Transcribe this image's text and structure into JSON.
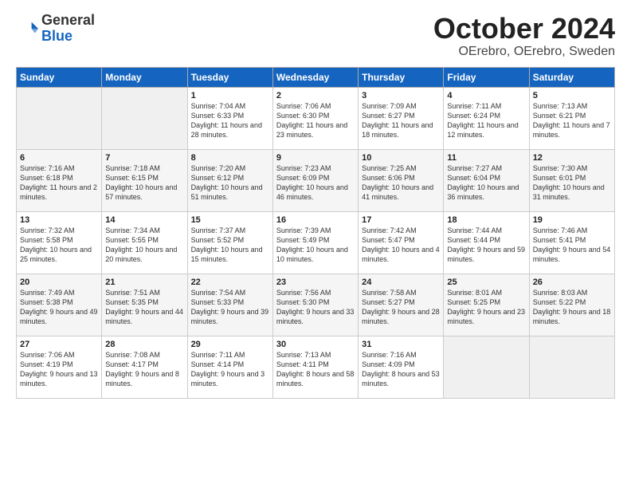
{
  "logo": {
    "general": "General",
    "blue": "Blue"
  },
  "title": "October 2024",
  "subtitle": "OErebro, OErebro, Sweden",
  "weekdays": [
    "Sunday",
    "Monday",
    "Tuesday",
    "Wednesday",
    "Thursday",
    "Friday",
    "Saturday"
  ],
  "weeks": [
    [
      {
        "day": "",
        "info": ""
      },
      {
        "day": "",
        "info": ""
      },
      {
        "day": "1",
        "info": "Sunrise: 7:04 AM\nSunset: 6:33 PM\nDaylight: 11 hours and 28 minutes."
      },
      {
        "day": "2",
        "info": "Sunrise: 7:06 AM\nSunset: 6:30 PM\nDaylight: 11 hours and 23 minutes."
      },
      {
        "day": "3",
        "info": "Sunrise: 7:09 AM\nSunset: 6:27 PM\nDaylight: 11 hours and 18 minutes."
      },
      {
        "day": "4",
        "info": "Sunrise: 7:11 AM\nSunset: 6:24 PM\nDaylight: 11 hours and 12 minutes."
      },
      {
        "day": "5",
        "info": "Sunrise: 7:13 AM\nSunset: 6:21 PM\nDaylight: 11 hours and 7 minutes."
      }
    ],
    [
      {
        "day": "6",
        "info": "Sunrise: 7:16 AM\nSunset: 6:18 PM\nDaylight: 11 hours and 2 minutes."
      },
      {
        "day": "7",
        "info": "Sunrise: 7:18 AM\nSunset: 6:15 PM\nDaylight: 10 hours and 57 minutes."
      },
      {
        "day": "8",
        "info": "Sunrise: 7:20 AM\nSunset: 6:12 PM\nDaylight: 10 hours and 51 minutes."
      },
      {
        "day": "9",
        "info": "Sunrise: 7:23 AM\nSunset: 6:09 PM\nDaylight: 10 hours and 46 minutes."
      },
      {
        "day": "10",
        "info": "Sunrise: 7:25 AM\nSunset: 6:06 PM\nDaylight: 10 hours and 41 minutes."
      },
      {
        "day": "11",
        "info": "Sunrise: 7:27 AM\nSunset: 6:04 PM\nDaylight: 10 hours and 36 minutes."
      },
      {
        "day": "12",
        "info": "Sunrise: 7:30 AM\nSunset: 6:01 PM\nDaylight: 10 hours and 31 minutes."
      }
    ],
    [
      {
        "day": "13",
        "info": "Sunrise: 7:32 AM\nSunset: 5:58 PM\nDaylight: 10 hours and 25 minutes."
      },
      {
        "day": "14",
        "info": "Sunrise: 7:34 AM\nSunset: 5:55 PM\nDaylight: 10 hours and 20 minutes."
      },
      {
        "day": "15",
        "info": "Sunrise: 7:37 AM\nSunset: 5:52 PM\nDaylight: 10 hours and 15 minutes."
      },
      {
        "day": "16",
        "info": "Sunrise: 7:39 AM\nSunset: 5:49 PM\nDaylight: 10 hours and 10 minutes."
      },
      {
        "day": "17",
        "info": "Sunrise: 7:42 AM\nSunset: 5:47 PM\nDaylight: 10 hours and 4 minutes."
      },
      {
        "day": "18",
        "info": "Sunrise: 7:44 AM\nSunset: 5:44 PM\nDaylight: 9 hours and 59 minutes."
      },
      {
        "day": "19",
        "info": "Sunrise: 7:46 AM\nSunset: 5:41 PM\nDaylight: 9 hours and 54 minutes."
      }
    ],
    [
      {
        "day": "20",
        "info": "Sunrise: 7:49 AM\nSunset: 5:38 PM\nDaylight: 9 hours and 49 minutes."
      },
      {
        "day": "21",
        "info": "Sunrise: 7:51 AM\nSunset: 5:35 PM\nDaylight: 9 hours and 44 minutes."
      },
      {
        "day": "22",
        "info": "Sunrise: 7:54 AM\nSunset: 5:33 PM\nDaylight: 9 hours and 39 minutes."
      },
      {
        "day": "23",
        "info": "Sunrise: 7:56 AM\nSunset: 5:30 PM\nDaylight: 9 hours and 33 minutes."
      },
      {
        "day": "24",
        "info": "Sunrise: 7:58 AM\nSunset: 5:27 PM\nDaylight: 9 hours and 28 minutes."
      },
      {
        "day": "25",
        "info": "Sunrise: 8:01 AM\nSunset: 5:25 PM\nDaylight: 9 hours and 23 minutes."
      },
      {
        "day": "26",
        "info": "Sunrise: 8:03 AM\nSunset: 5:22 PM\nDaylight: 9 hours and 18 minutes."
      }
    ],
    [
      {
        "day": "27",
        "info": "Sunrise: 7:06 AM\nSunset: 4:19 PM\nDaylight: 9 hours and 13 minutes."
      },
      {
        "day": "28",
        "info": "Sunrise: 7:08 AM\nSunset: 4:17 PM\nDaylight: 9 hours and 8 minutes."
      },
      {
        "day": "29",
        "info": "Sunrise: 7:11 AM\nSunset: 4:14 PM\nDaylight: 9 hours and 3 minutes."
      },
      {
        "day": "30",
        "info": "Sunrise: 7:13 AM\nSunset: 4:11 PM\nDaylight: 8 hours and 58 minutes."
      },
      {
        "day": "31",
        "info": "Sunrise: 7:16 AM\nSunset: 4:09 PM\nDaylight: 8 hours and 53 minutes."
      },
      {
        "day": "",
        "info": ""
      },
      {
        "day": "",
        "info": ""
      }
    ]
  ]
}
